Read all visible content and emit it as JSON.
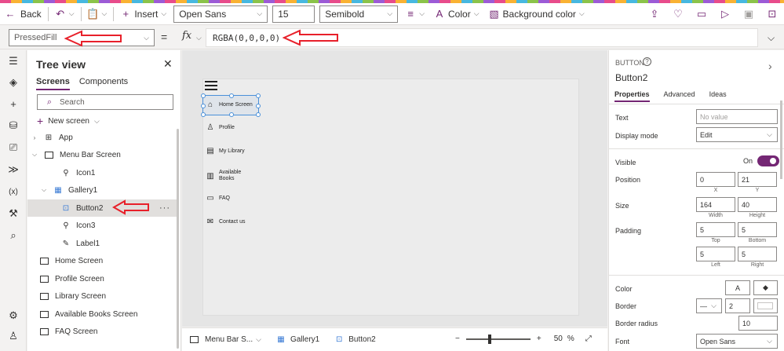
{
  "toolbar": {
    "back": "Back",
    "insert": "Insert",
    "font": "Open Sans",
    "font_size": "15",
    "font_weight": "Semibold",
    "color": "Color",
    "background_color": "Background color"
  },
  "formula": {
    "property": "PressedFill",
    "value": "RGBA(0,0,0,0)"
  },
  "tree": {
    "title": "Tree view",
    "tabs": [
      "Screens",
      "Components"
    ],
    "search_placeholder": "Search",
    "new_screen": "New screen",
    "items": [
      {
        "label": "App"
      },
      {
        "label": "Menu Bar Screen"
      },
      {
        "label": "Icon1"
      },
      {
        "label": "Gallery1"
      },
      {
        "label": "Button2"
      },
      {
        "label": "Icon3"
      },
      {
        "label": "Label1"
      },
      {
        "label": "Home Screen"
      },
      {
        "label": "Profile Screen"
      },
      {
        "label": "Library Screen"
      },
      {
        "label": "Available Books Screen"
      },
      {
        "label": "FAQ Screen"
      }
    ]
  },
  "canvas": {
    "menu": [
      {
        "label": "Home Screen"
      },
      {
        "label": "Profile"
      },
      {
        "label": "My Library"
      },
      {
        "label": "Available Books"
      },
      {
        "label": "FAQ"
      },
      {
        "label": "Contact us"
      }
    ]
  },
  "bottom": {
    "crumbs": [
      "Menu Bar S...",
      "Gallery1",
      "Button2"
    ],
    "zoom": "50",
    "zoom_unit": "%"
  },
  "props": {
    "type": "BUTTON",
    "name": "Button2",
    "tabs": [
      "Properties",
      "Advanced",
      "Ideas"
    ],
    "text_label": "Text",
    "text_placeholder": "No value",
    "display_mode_label": "Display mode",
    "display_mode": "Edit",
    "visible_label": "Visible",
    "visible_state": "On",
    "position_label": "Position",
    "pos_x": "0",
    "pos_y": "21",
    "x_label": "X",
    "y_label": "Y",
    "size_label": "Size",
    "width": "164",
    "height": "40",
    "width_label": "Width",
    "height_label": "Height",
    "padding_label": "Padding",
    "pad_top": "5",
    "pad_bottom": "5",
    "pad_left": "5",
    "pad_right": "5",
    "top_label": "Top",
    "bottom_label": "Bottom",
    "left_label": "Left",
    "right_label": "Right",
    "color_label": "Color",
    "color_glyph": "A",
    "border_label": "Border",
    "border_width": "2",
    "border_radius_label": "Border radius",
    "border_radius": "10",
    "font_label": "Font",
    "font": "Open Sans"
  },
  "colors": {
    "accent": "#742774",
    "annotation": "#e8202a",
    "selection": "#4a90d9"
  }
}
